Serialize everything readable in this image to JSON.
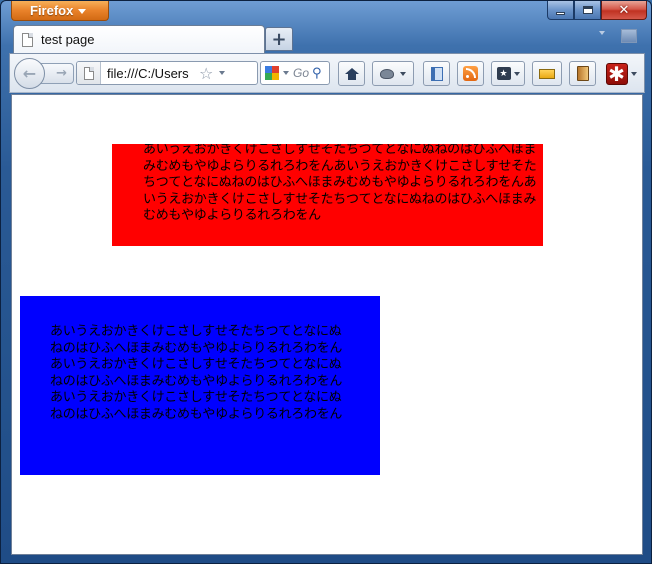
{
  "window": {
    "app_button_label": "Firefox",
    "controls": {
      "minimize": "minimize",
      "maximize": "maximize",
      "close": "✕"
    }
  },
  "tabs": [
    {
      "title": "test page",
      "icon": "page-icon"
    }
  ],
  "newtab_label": "+",
  "nav": {
    "url": "file:///C:/Users",
    "search_placeholder": "Go",
    "reload_glyph": "↻",
    "back_glyph": "←",
    "forward_glyph": "→"
  },
  "toolbar_icons": [
    "home-icon",
    "firebug-icon",
    "sidebar-icon",
    "rss-icon",
    "bookmark-icon",
    "ruler-icon",
    "book-icon",
    "asterisk-icon"
  ],
  "content": {
    "red_box": {
      "color": "#ff0000",
      "text": "あいうえおかきくけこさしすせそたちつてとなにぬねのはひふへほまみむめもやゆよらりるれろわをんあいうえおかきくけこさしすせそたちつてとなにぬねのはひふへほまみむめもやゆよらりるれろわをんあいうえおかきくけこさしすせそたちつてとなにぬねのはひふへほまみむめもやゆよらりるれろわをん"
    },
    "blue_box": {
      "color": "#0000ff",
      "text": "あいうえおかきくけこさしすせそたちつてとなにぬねのはひふへほまみむめもやゆよらりるれろわをんあいうえおかきくけこさしすせそたちつてとなにぬねのはひふへほまみむめもやゆよらりるれろわをんあいうえおかきくけこさしすせそたちつてとなにぬねのはひふへほまみむめもやゆよらりるれろわをん"
    }
  }
}
